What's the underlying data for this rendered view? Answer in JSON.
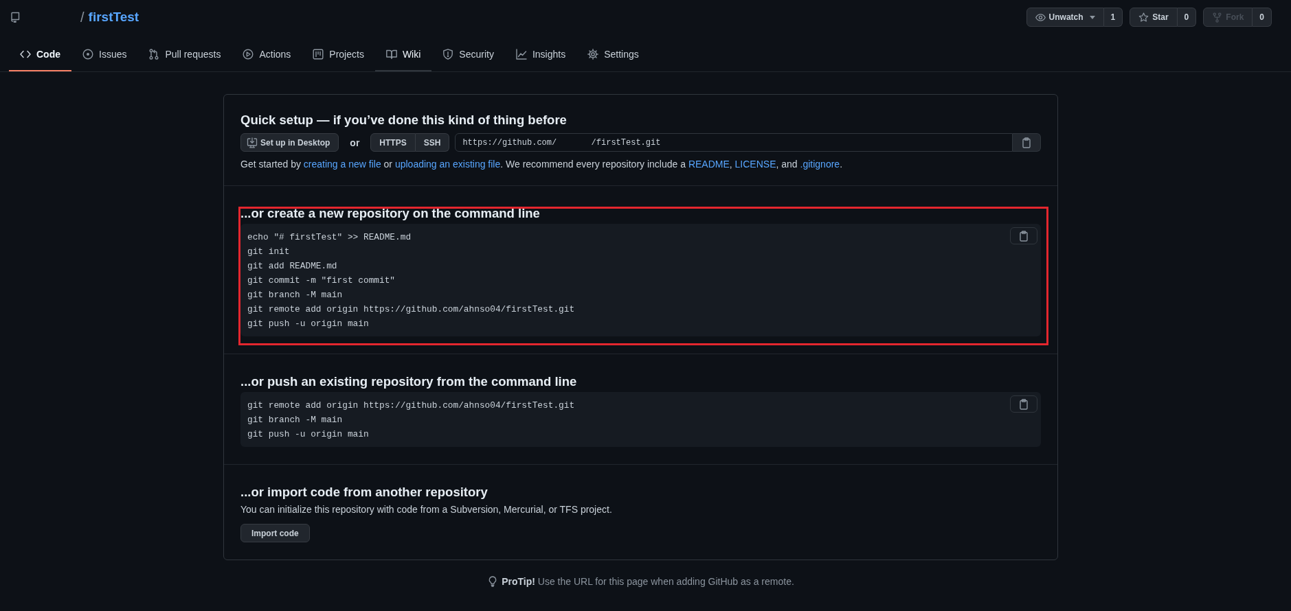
{
  "repo": {
    "separator": "/",
    "name": "firstTest"
  },
  "repo_actions": [
    {
      "kind": "watch",
      "label": "Unwatch",
      "count": "1",
      "dropdown": true,
      "disabled": false
    },
    {
      "kind": "star",
      "label": "Star",
      "count": "0",
      "dropdown": false,
      "disabled": false
    },
    {
      "kind": "fork",
      "label": "Fork",
      "count": "0",
      "dropdown": false,
      "disabled": true
    }
  ],
  "tabs": [
    {
      "label": "Code",
      "selected": true,
      "hovered": false
    },
    {
      "label": "Issues",
      "selected": false,
      "hovered": false
    },
    {
      "label": "Pull requests",
      "selected": false,
      "hovered": false
    },
    {
      "label": "Actions",
      "selected": false,
      "hovered": false
    },
    {
      "label": "Projects",
      "selected": false,
      "hovered": false
    },
    {
      "label": "Wiki",
      "selected": false,
      "hovered": true
    },
    {
      "label": "Security",
      "selected": false,
      "hovered": false
    },
    {
      "label": "Insights",
      "selected": false,
      "hovered": false
    },
    {
      "label": "Settings",
      "selected": false,
      "hovered": false
    }
  ],
  "quick_setup": {
    "title": "Quick setup — if you’ve done this kind of thing before",
    "desktop_button": "Set up in Desktop",
    "or": "or",
    "protocols": [
      "HTTPS",
      "SSH"
    ],
    "url": "https://github.com/       /firstTest.git",
    "help": [
      {
        "text": "Get started by ",
        "link": false
      },
      {
        "text": "creating a new file",
        "link": true
      },
      {
        "text": " or ",
        "link": false
      },
      {
        "text": "uploading an existing file",
        "link": true
      },
      {
        "text": ". We recommend every repository include a ",
        "link": false
      },
      {
        "text": "README",
        "link": true
      },
      {
        "text": ", ",
        "link": false
      },
      {
        "text": "LICENSE",
        "link": true
      },
      {
        "text": ", and ",
        "link": false
      },
      {
        "text": ".gitignore",
        "link": true
      },
      {
        "text": ".",
        "link": false
      }
    ]
  },
  "sections": [
    {
      "kind": "commands",
      "title": "...or create a new repository on the command line",
      "highlighted": true,
      "lines": [
        "echo \"# firstTest\" >> README.md",
        "git init",
        "git add README.md",
        "git commit -m \"first commit\"",
        "git branch -M main",
        "git remote add origin https://github.com/ahnso04/firstTest.git",
        "git push -u origin main"
      ]
    },
    {
      "kind": "commands",
      "title": "...or push an existing repository from the command line",
      "highlighted": false,
      "lines": [
        "git remote add origin https://github.com/ahnso04/firstTest.git",
        "git branch -M main",
        "git push -u origin main"
      ]
    },
    {
      "kind": "import",
      "title": "...or import code from another repository",
      "highlighted": false,
      "text": "You can initialize this repository with code from a Subversion, Mercurial, or TFS project.",
      "button": "Import code"
    }
  ],
  "protip": "**ProTip!** Use the URL for this page when adding GitHub as a remote."
}
